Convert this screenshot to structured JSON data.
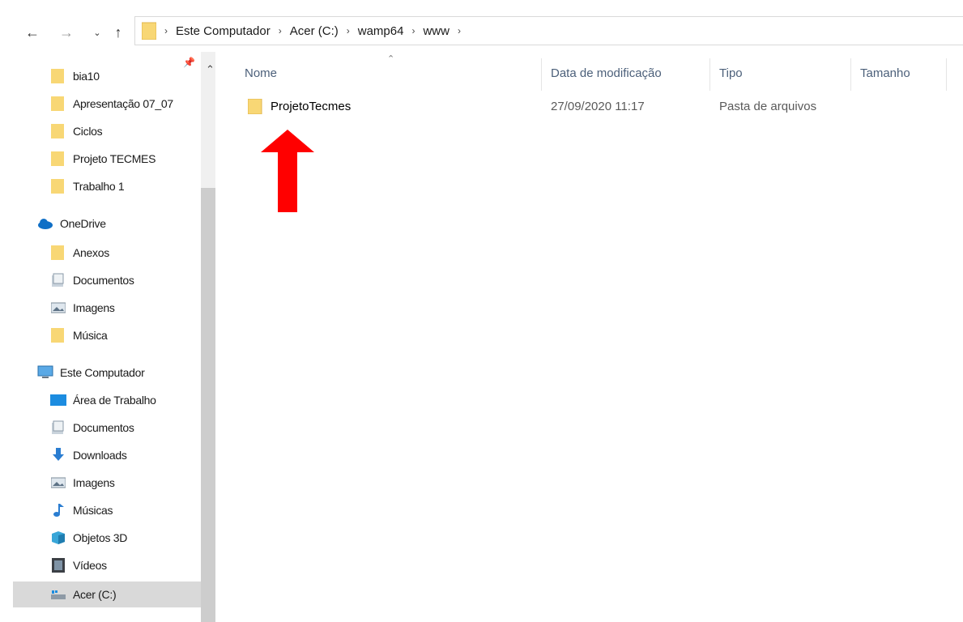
{
  "address_bar": {
    "breadcrumbs": [
      "Este Computador",
      "Acer (C:)",
      "wamp64",
      "www"
    ]
  },
  "sidebar": {
    "items": [
      {
        "label": "bia10",
        "icon": "folder-icon"
      },
      {
        "label": "Apresentação 07_07",
        "icon": "folder-icon"
      },
      {
        "label": "Ciclos",
        "icon": "folder-icon"
      },
      {
        "label": "Projeto TECMES",
        "icon": "folder-icon"
      },
      {
        "label": "Trabalho 1",
        "icon": "folder-icon"
      },
      {
        "label": "OneDrive",
        "icon": "cloud-icon"
      },
      {
        "label": "Anexos",
        "icon": "folder-icon"
      },
      {
        "label": "Documentos",
        "icon": "documents-icon"
      },
      {
        "label": "Imagens",
        "icon": "pictures-icon"
      },
      {
        "label": "Música",
        "icon": "folder-icon"
      },
      {
        "label": "Este Computador",
        "icon": "computer-icon"
      },
      {
        "label": "Área de Trabalho",
        "icon": "desktop-icon"
      },
      {
        "label": "Documentos",
        "icon": "documents-icon"
      },
      {
        "label": "Downloads",
        "icon": "download-icon"
      },
      {
        "label": "Imagens",
        "icon": "pictures-icon"
      },
      {
        "label": "Músicas",
        "icon": "music-icon"
      },
      {
        "label": "Objetos 3D",
        "icon": "objects-3d-icon"
      },
      {
        "label": "Vídeos",
        "icon": "videos-icon"
      },
      {
        "label": "Acer (C:)",
        "icon": "drive-icon"
      }
    ],
    "selected": "Acer (C:)"
  },
  "file_list": {
    "columns": [
      "Nome",
      "Data de modificação",
      "Tipo",
      "Tamanho"
    ],
    "rows": [
      {
        "name": "ProjetoTecmes",
        "modified": "27/09/2020 11:17",
        "type": "Pasta de arquivos",
        "size": ""
      }
    ]
  },
  "annotation": {
    "arrow_color": "#ff0000",
    "arrow_direction": "up"
  },
  "colors": {
    "folder": "#f8d775",
    "header_text": "#4c607a",
    "selected_bg": "#d9d9d9"
  }
}
